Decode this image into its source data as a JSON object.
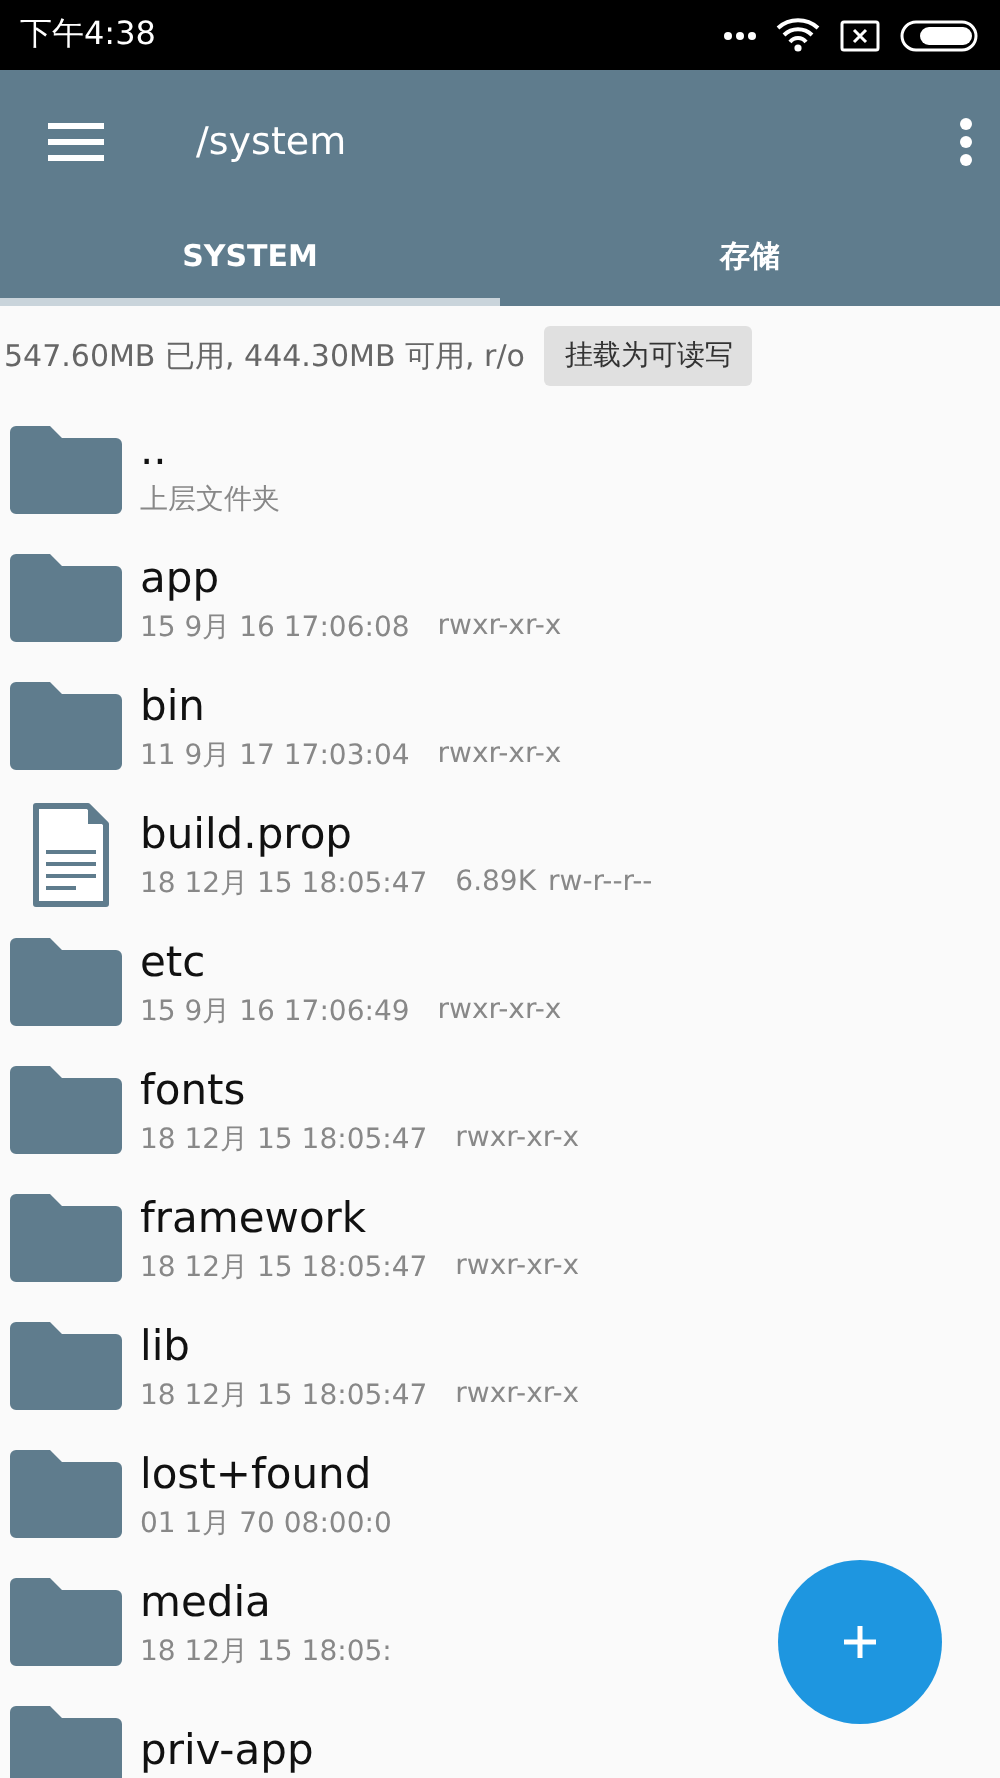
{
  "status_bar": {
    "time": "下午4:38"
  },
  "toolbar": {
    "title": "/system"
  },
  "tabs": [
    {
      "label": "SYSTEM",
      "selected": true
    },
    {
      "label": "存储",
      "selected": false
    }
  ],
  "storage": {
    "info": "547.60MB 已用, 444.30MB 可用, r/o",
    "button": "挂载为可读写"
  },
  "files": [
    {
      "kind": "folder",
      "name": "..",
      "detail": "上层文件夹"
    },
    {
      "kind": "folder",
      "name": "app",
      "date": "15 9月 16 17:06:08",
      "permissions": "rwxr-xr-x"
    },
    {
      "kind": "folder",
      "name": "bin",
      "date": "11 9月 17 17:03:04",
      "permissions": "rwxr-xr-x"
    },
    {
      "kind": "file",
      "name": "build.prop",
      "date": "18 12月 15 18:05:47",
      "size": "6.89K",
      "permissions": "rw-r--r--"
    },
    {
      "kind": "folder",
      "name": "etc",
      "date": "15 9月 16 17:06:49",
      "permissions": "rwxr-xr-x"
    },
    {
      "kind": "folder",
      "name": "fonts",
      "date": "18 12月 15 18:05:47",
      "permissions": "rwxr-xr-x"
    },
    {
      "kind": "folder",
      "name": "framework",
      "date": "18 12月 15 18:05:47",
      "permissions": "rwxr-xr-x"
    },
    {
      "kind": "folder",
      "name": "lib",
      "date": "18 12月 15 18:05:47",
      "permissions": "rwxr-xr-x"
    },
    {
      "kind": "folder",
      "name": "lost+found",
      "date": "01 1月 70 08:00:0"
    },
    {
      "kind": "folder",
      "name": "media",
      "date": "18 12月 15 18:05:"
    },
    {
      "kind": "folder",
      "name": "priv-app"
    }
  ]
}
